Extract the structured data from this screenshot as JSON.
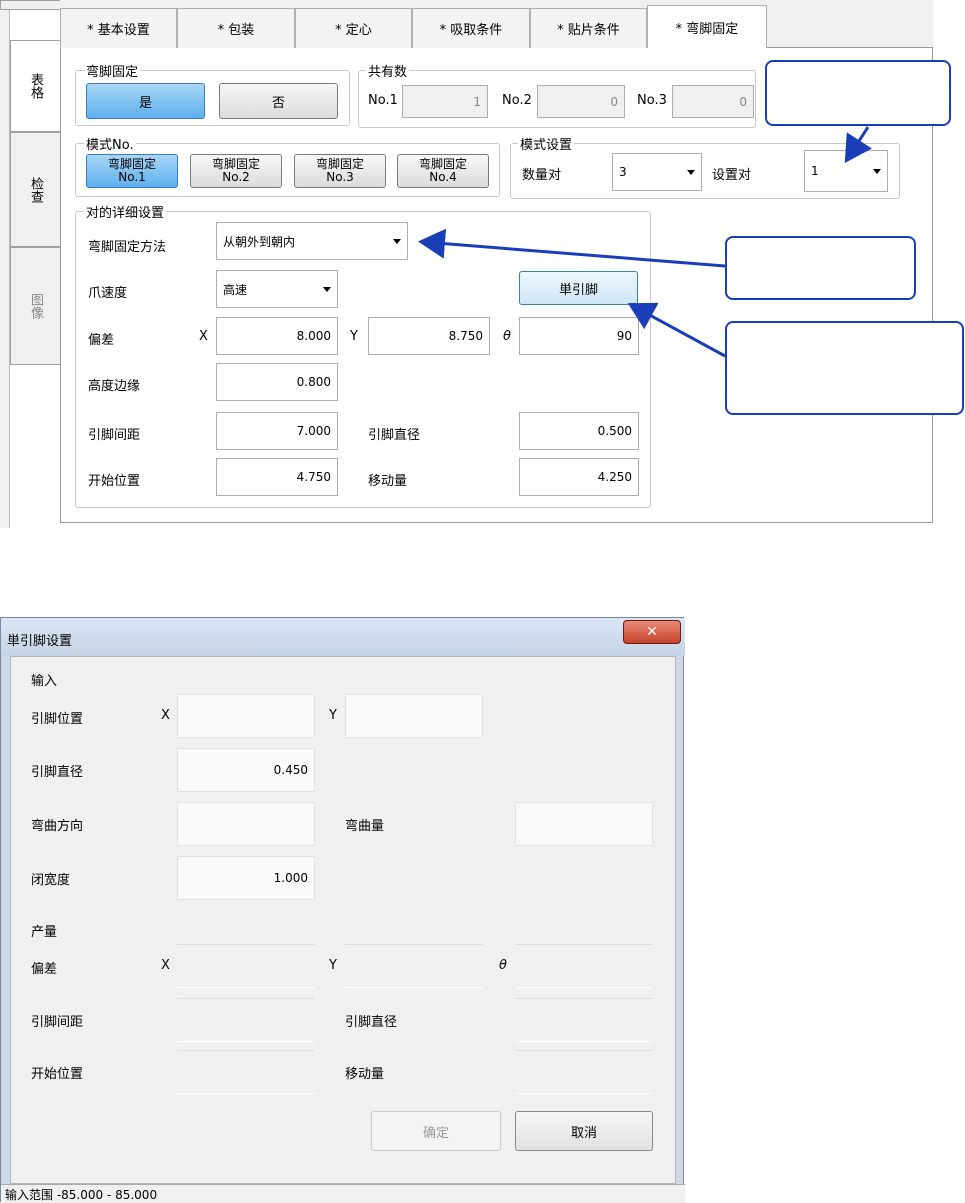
{
  "top": {
    "vtabs": [
      "表格",
      "检查",
      "图像"
    ],
    "tabs": [
      "* 基本设置",
      "* 包装",
      "* 定心",
      "* 吸取条件",
      "* 贴片条件",
      "* 弯脚固定"
    ],
    "bend_fix": {
      "title": "弯脚固定",
      "yes": "是",
      "no": "否"
    },
    "shared": {
      "title": "共有数",
      "no1_label": "No.1",
      "no1_value": "1",
      "no2_label": "No.2",
      "no2_value": "0",
      "no3_label": "No.3",
      "no3_value": "0"
    },
    "pattern_no": {
      "title": "模式No.",
      "buttons": [
        {
          "line1": "弯脚固定",
          "line2": "No.1"
        },
        {
          "line1": "弯脚固定",
          "line2": "No.2"
        },
        {
          "line1": "弯脚固定",
          "line2": "No.3"
        },
        {
          "line1": "弯脚固定",
          "line2": "No.4"
        }
      ]
    },
    "pattern_set": {
      "title": "模式设置",
      "count_label": "数量对",
      "count_value": "3",
      "set_label": "设置对",
      "set_value": "1"
    },
    "detail": {
      "title": "对的详细设置",
      "method_label": "弯脚固定方法",
      "method_value": "从朝外到朝内",
      "speed_label": "爪速度",
      "speed_value": "高速",
      "single_btn": "単引脚",
      "offset_label": "偏差",
      "x": "X",
      "x_value": "8.000",
      "y": "Y",
      "y_value": "8.750",
      "theta": "θ",
      "theta_value": "90",
      "height_label": "高度边缘",
      "height_value": "0.800",
      "pitch_label": "引脚间距",
      "pitch_value": "7.000",
      "dia_label": "引脚直径",
      "dia_value": "0.500",
      "start_label": "开始位置",
      "start_value": "4.750",
      "move_label": "移动量",
      "move_value": "4.250"
    }
  },
  "dialog": {
    "title": "単引脚设置",
    "close": "✕",
    "input_title": "输入",
    "pos_label": "引脚位置",
    "x": "X",
    "y": "Y",
    "dia_label": "引脚直径",
    "dia_value": "0.450",
    "bend_dir_label": "弯曲方向",
    "bend_amt_label": "弯曲量",
    "close_width_label": "闭宽度",
    "close_width_value": "1.000",
    "output_title": "产量",
    "offset_label": "偏差",
    "theta": "θ",
    "pitch_label": "引脚间距",
    "out_dia_label": "引脚直径",
    "start_label": "开始位置",
    "move_label": "移动量",
    "ok": "确定",
    "cancel": "取消",
    "status": "输入范围 -85.000 - 85.000"
  }
}
